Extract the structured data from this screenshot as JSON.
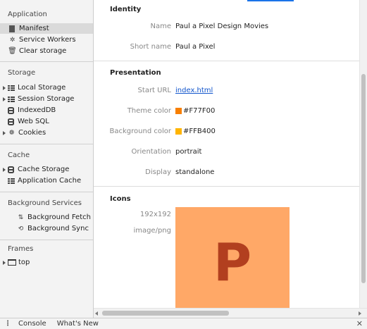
{
  "sidebar": {
    "application": {
      "title": "Application",
      "items": [
        {
          "label": "Manifest",
          "icon": "manifest-icon"
        },
        {
          "label": "Service Workers",
          "icon": "gear-icon"
        },
        {
          "label": "Clear storage",
          "icon": "trash-icon"
        }
      ]
    },
    "storage": {
      "title": "Storage",
      "items": [
        {
          "label": "Local Storage",
          "icon": "table-icon"
        },
        {
          "label": "Session Storage",
          "icon": "table-icon"
        },
        {
          "label": "IndexedDB",
          "icon": "database-icon"
        },
        {
          "label": "Web SQL",
          "icon": "database-icon"
        },
        {
          "label": "Cookies",
          "icon": "cookie-icon"
        }
      ]
    },
    "cache": {
      "title": "Cache",
      "items": [
        {
          "label": "Cache Storage",
          "icon": "database-icon"
        },
        {
          "label": "Application Cache",
          "icon": "table-icon"
        }
      ]
    },
    "background_services": {
      "title": "Background Services",
      "items": [
        {
          "label": "Background Fetch",
          "icon": "arrows-icon"
        },
        {
          "label": "Background Sync",
          "icon": "sync-icon"
        }
      ]
    },
    "frames": {
      "title": "Frames",
      "items": [
        {
          "label": "top",
          "icon": "frame-icon"
        }
      ]
    }
  },
  "manifest": {
    "identity": {
      "title": "Identity",
      "name_label": "Name",
      "name_value": "Paul a Pixel Design Movies",
      "short_name_label": "Short name",
      "short_name_value": "Paul a Pixel"
    },
    "presentation": {
      "title": "Presentation",
      "start_url_label": "Start URL",
      "start_url_value": "index.html",
      "theme_color_label": "Theme color",
      "theme_color_value": "#F77F00",
      "background_color_label": "Background color",
      "background_color_value": "#FFB400",
      "orientation_label": "Orientation",
      "orientation_value": "portrait",
      "display_label": "Display",
      "display_value": "standalone"
    },
    "icons": {
      "title": "Icons",
      "size": "192x192",
      "type": "image/png",
      "icon_letter": "P",
      "icon_bg_color": "#FFA867",
      "icon_fg_color": "#B23F1F"
    }
  },
  "drawer": {
    "tabs": [
      "Console",
      "What's New"
    ]
  },
  "colors": {
    "accent": "#1A73E8",
    "link": "#1155CC",
    "selected_bg": "#DADADA"
  }
}
